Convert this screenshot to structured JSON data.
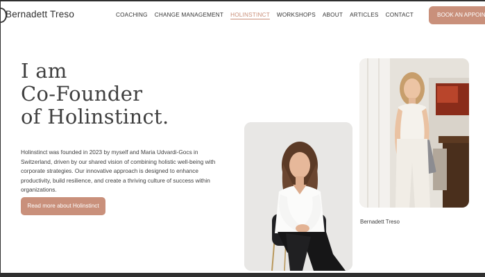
{
  "header": {
    "brand": "Bernadett Treso",
    "nav": [
      {
        "label": "COACHING",
        "active": false
      },
      {
        "label": "CHANGE MANAGEMENT",
        "active": false
      },
      {
        "label": "HOLINSTINCT",
        "active": true
      },
      {
        "label": "WORKSHOPS",
        "active": false
      },
      {
        "label": "ABOUT",
        "active": false
      },
      {
        "label": "ARTICLES",
        "active": false
      },
      {
        "label": "CONTACT",
        "active": false
      }
    ],
    "cta_label": "BOOK AN APPOINTM"
  },
  "hero": {
    "title_lines": [
      "I am",
      "Co-Founder",
      "of Holinstinct."
    ],
    "body": "Holinstinct was founded in 2023 by myself and Maria Udvardi-Gocs in Switzerland, driven by our shared vision of combining holistic well-being with corporate strategies. Our innovative approach is designed to enhance productivity, build resilience, and create a thriving culture of success within organizations.",
    "button_label": "Read more about Holinstinct"
  },
  "photos": {
    "caption": "Bernadett Treso"
  },
  "colors": {
    "accent": "#c9907b",
    "text": "#3a3a3a",
    "background": "#ffffff"
  }
}
